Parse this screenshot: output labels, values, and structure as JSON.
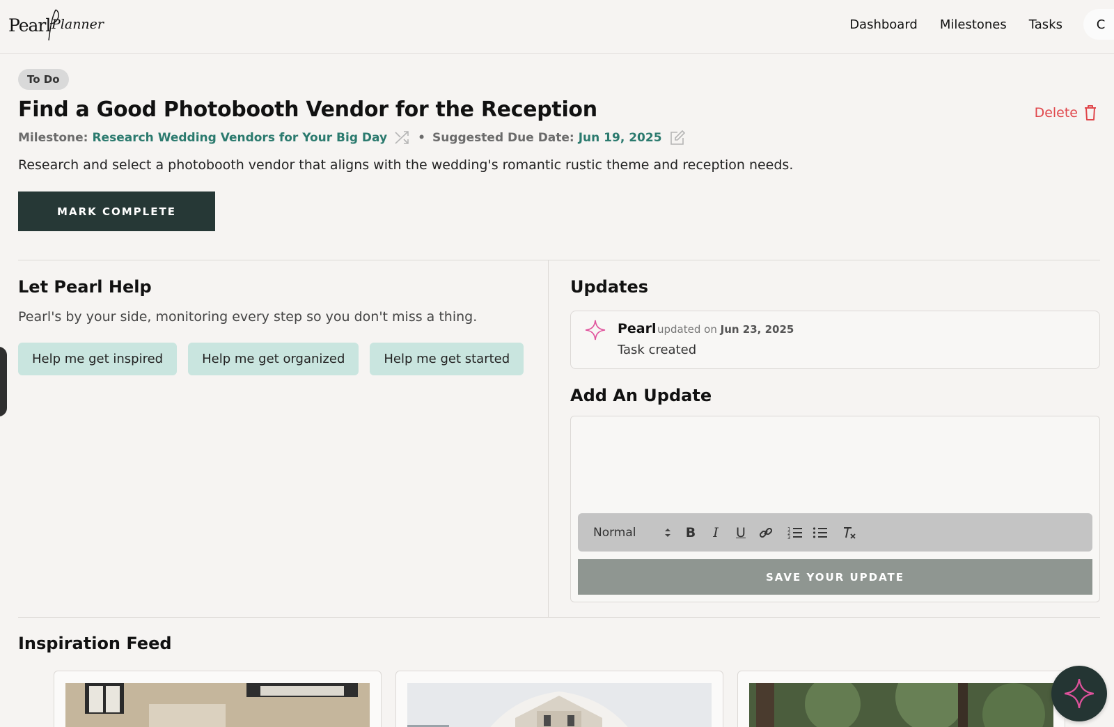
{
  "brand": {
    "logo_text_1": "Pearl",
    "logo_text_2": "Planner"
  },
  "nav": {
    "items": [
      {
        "label": "Dashboard"
      },
      {
        "label": "Milestones"
      },
      {
        "label": "Tasks"
      }
    ],
    "avatar_initial": "C"
  },
  "task": {
    "status": "To Do",
    "title": "Find a Good Photobooth Vendor for the Reception",
    "delete_label": "Delete",
    "milestone_label": "Milestone:",
    "milestone_value": "Research Wedding Vendors for Your Big Day",
    "due_label": "Suggested Due Date:",
    "due_value": "Jun 19, 2025",
    "description": "Research and select a photobooth vendor that aligns with the wedding's romantic rustic theme and reception needs.",
    "complete_button": "MARK COMPLETE"
  },
  "help": {
    "title": "Let Pearl Help",
    "description": "Pearl's by your side, monitoring every step so you don't miss a thing.",
    "buttons": [
      {
        "label": "Help me get inspired"
      },
      {
        "label": "Help me get organized"
      },
      {
        "label": "Help me get started"
      }
    ]
  },
  "updates": {
    "title": "Updates",
    "items": [
      {
        "author": "Pearl",
        "prefix": "updated on",
        "date": "Jun 23, 2025",
        "text": "Task created"
      }
    ],
    "add_title": "Add An Update",
    "editor": {
      "format": "Normal",
      "save_button": "SAVE YOUR UPDATE"
    }
  },
  "feed": {
    "title": "Inspiration Feed"
  },
  "colors": {
    "accent_teal": "#2b7a6e",
    "dark_green": "#263836",
    "delete_red": "#e0474c",
    "help_button_bg": "#c9e5df",
    "pearl_pink": "#e0529c"
  }
}
